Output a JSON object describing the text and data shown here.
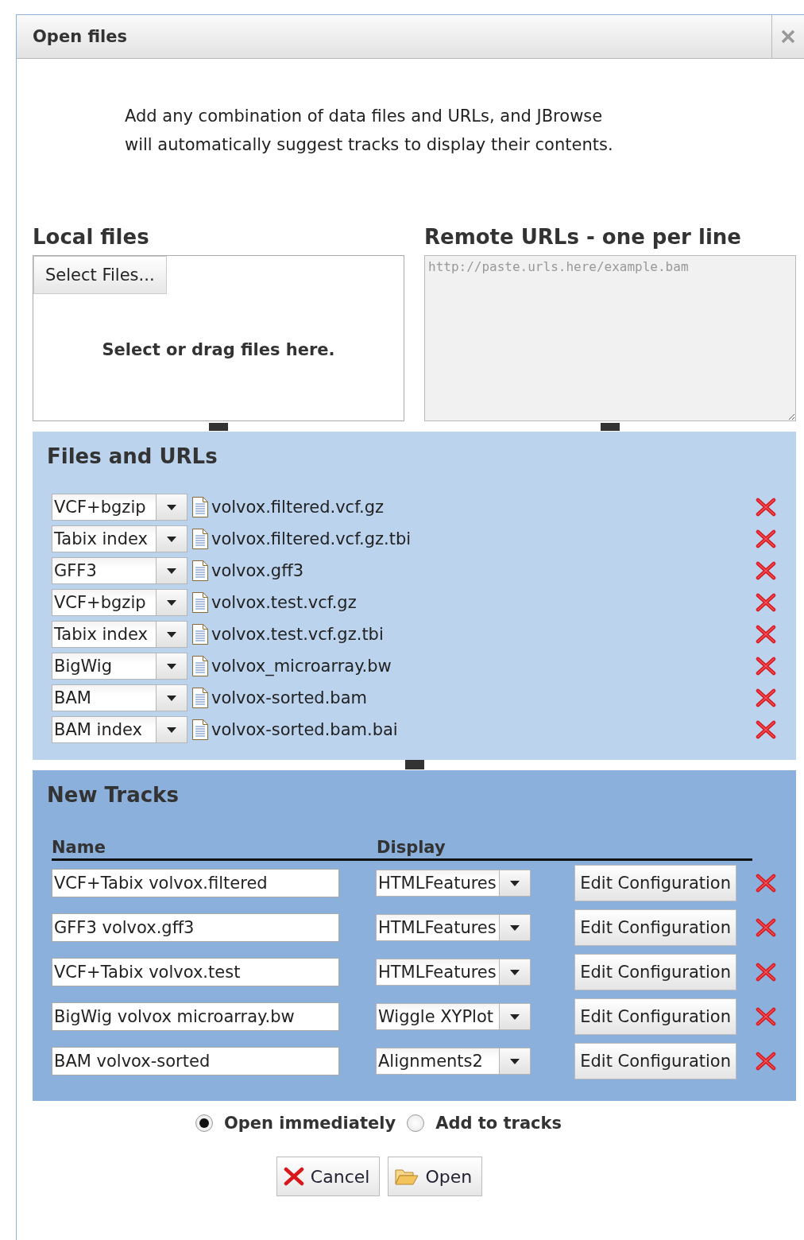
{
  "dialog": {
    "title": "Open files"
  },
  "intro": "Add any combination of data files and URLs, and JBrowse will automatically suggest tracks to display their contents.",
  "local_files": {
    "heading": "Local files",
    "button": "Select Files...",
    "drop_hint": "Select or drag files here."
  },
  "remote_urls": {
    "heading": "Remote URLs - one per line",
    "placeholder": "http://paste.urls.here/example.bam"
  },
  "files_and_urls": {
    "heading": "Files and URLs",
    "files": [
      {
        "type": "VCF+bgzip",
        "name": "volvox.filtered.vcf.gz"
      },
      {
        "type": "Tabix index",
        "name": "volvox.filtered.vcf.gz.tbi"
      },
      {
        "type": "GFF3",
        "name": "volvox.gff3"
      },
      {
        "type": "VCF+bgzip",
        "name": "volvox.test.vcf.gz"
      },
      {
        "type": "Tabix index",
        "name": "volvox.test.vcf.gz.tbi"
      },
      {
        "type": "BigWig",
        "name": "volvox_microarray.bw"
      },
      {
        "type": "BAM",
        "name": "volvox-sorted.bam"
      },
      {
        "type": "BAM index",
        "name": "volvox-sorted.bam.bai"
      }
    ]
  },
  "new_tracks": {
    "heading": "New Tracks",
    "columns": [
      "Name",
      "Display"
    ],
    "tracks": [
      {
        "name": "VCF+Tabix volvox.filtered",
        "display": "HTMLFeatures",
        "edit_button": "Edit Configuration"
      },
      {
        "name": "GFF3 volvox.gff3",
        "display": "HTMLFeatures",
        "edit_button": "Edit Configuration"
      },
      {
        "name": "VCF+Tabix volvox.test",
        "display": "HTMLFeatures",
        "edit_button": "Edit Configuration"
      },
      {
        "name": "BigWig volvox microarray.bw",
        "display": "Wiggle XYPlot",
        "edit_button": "Edit Configuration"
      },
      {
        "name": "BAM volvox-sorted",
        "display": "Alignments2",
        "edit_button": "Edit Configuration"
      }
    ]
  },
  "open_mode": [
    {
      "label": "Open immediately",
      "selected": true
    },
    {
      "label": "Add to tracks",
      "selected": false
    }
  ],
  "buttons": [
    {
      "kind": "cancel",
      "label": "Cancel"
    },
    {
      "kind": "open",
      "label": "Open"
    }
  ]
}
